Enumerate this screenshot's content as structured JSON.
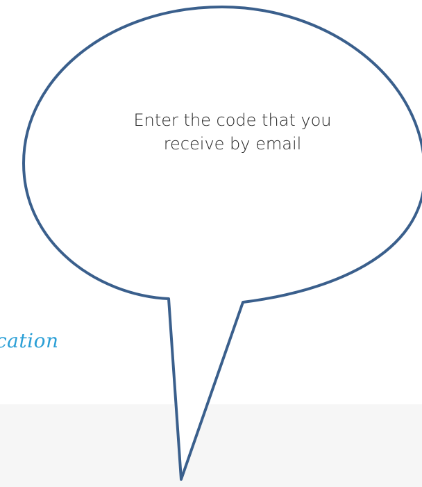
{
  "background_page": {
    "heading_fragment": "cation",
    "accent_color": "#2a9fd6",
    "panel_color": "#f6f6f6"
  },
  "callout": {
    "line1": "Enter the code that you",
    "line2": "receive by email",
    "border_color": "#3a5f8c",
    "fill_color": "#ffffff"
  }
}
